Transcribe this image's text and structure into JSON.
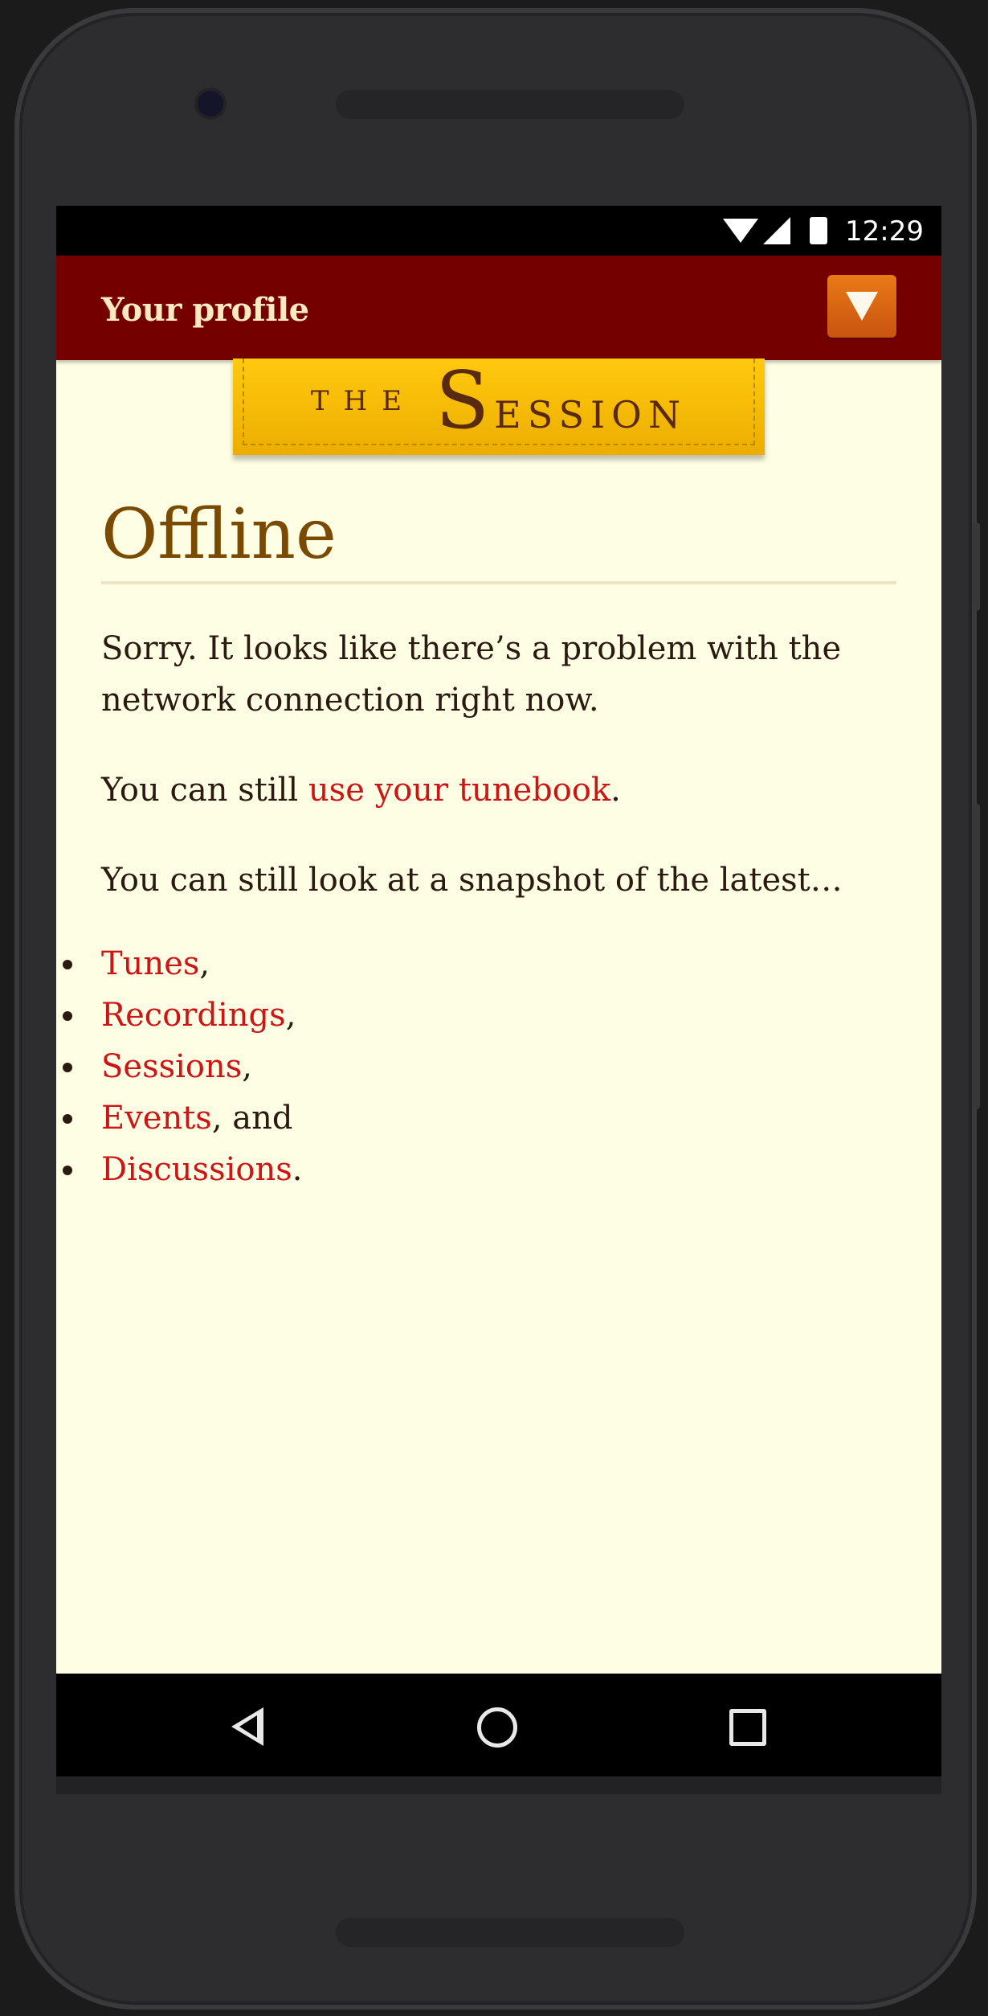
{
  "status": {
    "time": "12:29"
  },
  "header": {
    "profile_label": "Your profile"
  },
  "logo": {
    "the": "THE",
    "session_cap": "S",
    "session_rest": "ESSION"
  },
  "main": {
    "title": "Offline",
    "intro": "Sorry. It looks like there’s a problem with the network connection right now.",
    "tunebook_prefix": "You can still ",
    "tunebook_link": "use your tunebook",
    "tunebook_suffix": ".",
    "snapshot_text": "You can still look at a snapshot of the latest…",
    "links": [
      {
        "label": "Tunes",
        "suffix": ","
      },
      {
        "label": "Recordings",
        "suffix": ","
      },
      {
        "label": "Sessions",
        "suffix": ","
      },
      {
        "label": "Events",
        "suffix": ", and"
      },
      {
        "label": "Discussions",
        "suffix": "."
      }
    ]
  },
  "colors": {
    "header_bg": "#740000",
    "page_bg": "#fefee4",
    "link": "#cc1616",
    "title": "#7a4a00",
    "logo_bg": "#ffc90e",
    "menu_button": "#e06a14"
  },
  "icons": {
    "menu": "triangle-down-icon",
    "nav_back": "back-triangle-icon",
    "nav_home": "home-circle-icon",
    "nav_recent": "recent-square-icon"
  }
}
